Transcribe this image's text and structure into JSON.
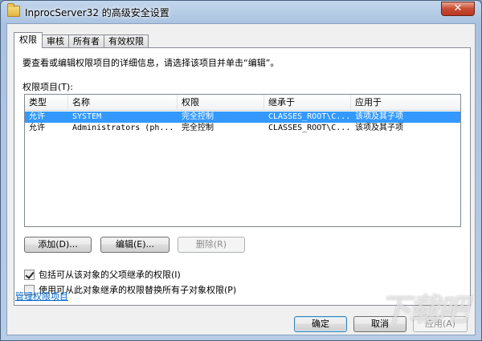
{
  "window": {
    "title": "InprocServer32 的高级安全设置",
    "close_label": "✕"
  },
  "tabs": [
    {
      "label": "权限",
      "active": true
    },
    {
      "label": "审核",
      "active": false
    },
    {
      "label": "所有者",
      "active": false
    },
    {
      "label": "有效权限",
      "active": false
    }
  ],
  "permissions": {
    "description": "要查看或编辑权限项目的详细信息，请选择该项目并单击“编辑”。",
    "list_label": "权限项目(T):",
    "columns": [
      "类型",
      "名称",
      "权限",
      "继承于",
      "应用于"
    ],
    "rows": [
      {
        "type": "允许",
        "name": "SYSTEM",
        "permission": "完全控制",
        "inherited_from": "CLASSES_ROOT\\C...",
        "applies_to": "该项及其子项",
        "selected": true
      },
      {
        "type": "允许",
        "name": "Administrators (ph...",
        "permission": "完全控制",
        "inherited_from": "CLASSES_ROOT\\C...",
        "applies_to": "该项及其子项",
        "selected": false
      }
    ],
    "buttons": {
      "add": "添加(D)...",
      "edit": "编辑(E)...",
      "remove": "删除(R)"
    },
    "checkboxes": {
      "include_inheritable": {
        "label": "包括可从该对象的父项继承的权限(I)",
        "checked": true
      },
      "replace_child": {
        "label": "使用可从此对象继承的权限替换所有子对象权限(P)",
        "checked": false
      }
    },
    "manage_link": "管理权限项目"
  },
  "footer": {
    "ok": "确定",
    "cancel": "取消",
    "apply": "应用(A)"
  },
  "watermark": "下载吧"
}
